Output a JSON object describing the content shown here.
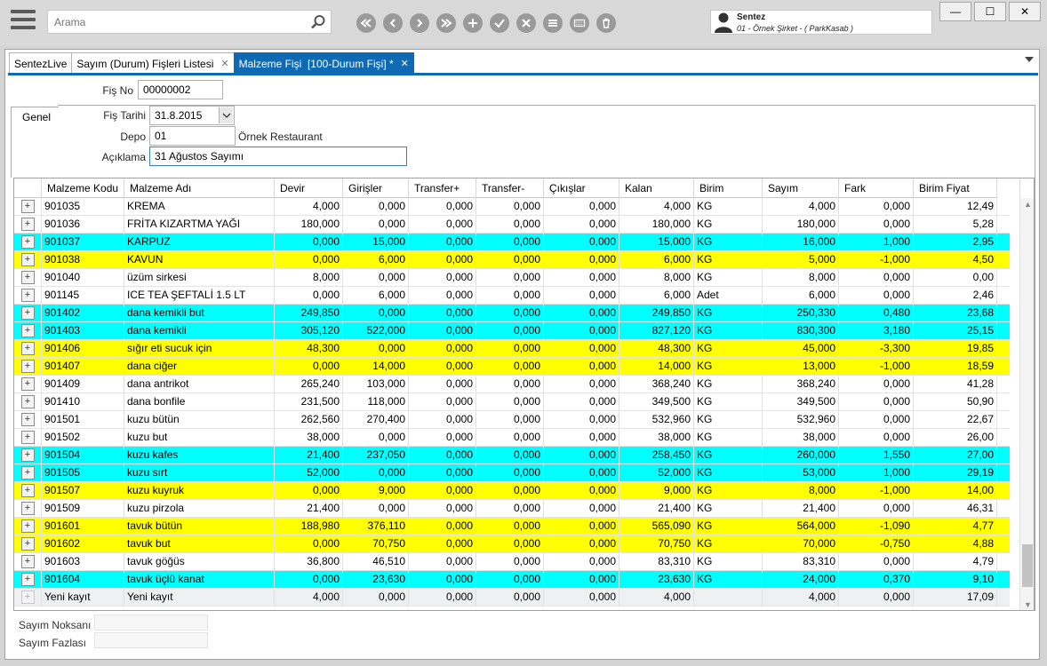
{
  "search": {
    "placeholder": "Arama"
  },
  "toolbar": [
    "first-icon",
    "prev-icon",
    "next-icon",
    "last-icon",
    "add-icon",
    "confirm-icon",
    "cancel-icon",
    "list-icon",
    "keyboard-icon",
    "delete-icon"
  ],
  "user": {
    "name": "Sentez",
    "company": "01 - Örnek Şirket - ( ParkKasab )"
  },
  "window": {
    "minimize": "—",
    "maximize": "☐",
    "close": "✕"
  },
  "tabs": [
    {
      "label": "SentezLive",
      "closable": false
    },
    {
      "label": "Sayım (Durum) Fişleri Listesi",
      "closable": true
    },
    {
      "label": "Malzeme Fişi  [100-Durum Fişi] *",
      "closable": true,
      "active": true
    }
  ],
  "form": {
    "fis_no_label": "Fiş No",
    "fis_no": "00000002",
    "genel_tab": "Genel",
    "fis_tarihi_label": "Fiş Tarihi",
    "fis_tarihi": "31.8.2015",
    "depo_label": "Depo",
    "depo_code": "01",
    "depo_name": "Örnek Restaurant",
    "aciklama_label": "Açıklama",
    "aciklama": "31 Ağustos Sayımı"
  },
  "grid": {
    "columns": [
      "Malzeme Kodu",
      "Malzeme Adı",
      "Devir",
      "Girişler",
      "Transfer+",
      "Transfer-",
      "Çıkışlar",
      "Kalan",
      "Birim",
      "Sayım",
      "Fark",
      "Birim Fiyat"
    ],
    "rows": [
      {
        "kod": "901035",
        "ad": "KREMA",
        "devir": "4,000",
        "giris": "0,000",
        "tplus": "0,000",
        "tminus": "0,000",
        "cikis": "0,000",
        "kalan": "4,000",
        "birim": "KG",
        "sayim": "4,000",
        "fark": "0,000",
        "fiyat": "12,49",
        "color": "#ffffff"
      },
      {
        "kod": "901036",
        "ad": "FRİTA KIZARTMA YAĞI",
        "devir": "180,000",
        "giris": "0,000",
        "tplus": "0,000",
        "tminus": "0,000",
        "cikis": "0,000",
        "kalan": "180,000",
        "birim": "KG",
        "sayim": "180,000",
        "fark": "0,000",
        "fiyat": "5,28",
        "color": "#ffffff"
      },
      {
        "kod": "901037",
        "ad": "KARPUZ",
        "devir": "0,000",
        "giris": "15,000",
        "tplus": "0,000",
        "tminus": "0,000",
        "cikis": "0,000",
        "kalan": "15,000",
        "birim": "KG",
        "sayim": "16,000",
        "fark": "1,000",
        "fiyat": "2,95",
        "color": "#00ffff"
      },
      {
        "kod": "901038",
        "ad": "KAVUN",
        "devir": "0,000",
        "giris": "6,000",
        "tplus": "0,000",
        "tminus": "0,000",
        "cikis": "0,000",
        "kalan": "6,000",
        "birim": "KG",
        "sayim": "5,000",
        "fark": "-1,000",
        "fiyat": "4,50",
        "color": "#ffff00"
      },
      {
        "kod": "901040",
        "ad": "üzüm sirkesi",
        "devir": "8,000",
        "giris": "0,000",
        "tplus": "0,000",
        "tminus": "0,000",
        "cikis": "0,000",
        "kalan": "8,000",
        "birim": "KG",
        "sayim": "8,000",
        "fark": "0,000",
        "fiyat": "0,00",
        "color": "#ffffff"
      },
      {
        "kod": "901145",
        "ad": "ICE TEA ŞEFTALİ 1.5 LT",
        "devir": "0,000",
        "giris": "6,000",
        "tplus": "0,000",
        "tminus": "0,000",
        "cikis": "0,000",
        "kalan": "6,000",
        "birim": "Adet",
        "sayim": "6,000",
        "fark": "0,000",
        "fiyat": "2,46",
        "color": "#ffffff"
      },
      {
        "kod": "901402",
        "ad": "dana kemikli but",
        "devir": "249,850",
        "giris": "0,000",
        "tplus": "0,000",
        "tminus": "0,000",
        "cikis": "0,000",
        "kalan": "249,850",
        "birim": "KG",
        "sayim": "250,330",
        "fark": "0,480",
        "fiyat": "23,68",
        "color": "#00ffff"
      },
      {
        "kod": "901403",
        "ad": "dana kemikli",
        "devir": "305,120",
        "giris": "522,000",
        "tplus": "0,000",
        "tminus": "0,000",
        "cikis": "0,000",
        "kalan": "827,120",
        "birim": "KG",
        "sayim": "830,300",
        "fark": "3,180",
        "fiyat": "25,15",
        "color": "#00ffff"
      },
      {
        "kod": "901406",
        "ad": "sığır eti sucuk için",
        "devir": "48,300",
        "giris": "0,000",
        "tplus": "0,000",
        "tminus": "0,000",
        "cikis": "0,000",
        "kalan": "48,300",
        "birim": "KG",
        "sayim": "45,000",
        "fark": "-3,300",
        "fiyat": "19,85",
        "color": "#ffff00"
      },
      {
        "kod": "901407",
        "ad": "dana ciğer",
        "devir": "0,000",
        "giris": "14,000",
        "tplus": "0,000",
        "tminus": "0,000",
        "cikis": "0,000",
        "kalan": "14,000",
        "birim": "KG",
        "sayim": "13,000",
        "fark": "-1,000",
        "fiyat": "18,59",
        "color": "#ffff00"
      },
      {
        "kod": "901409",
        "ad": "dana antrikot",
        "devir": "265,240",
        "giris": "103,000",
        "tplus": "0,000",
        "tminus": "0,000",
        "cikis": "0,000",
        "kalan": "368,240",
        "birim": "KG",
        "sayim": "368,240",
        "fark": "0,000",
        "fiyat": "41,28",
        "color": "#ffffff"
      },
      {
        "kod": "901410",
        "ad": "dana bonfile",
        "devir": "231,500",
        "giris": "118,000",
        "tplus": "0,000",
        "tminus": "0,000",
        "cikis": "0,000",
        "kalan": "349,500",
        "birim": "KG",
        "sayim": "349,500",
        "fark": "0,000",
        "fiyat": "50,90",
        "color": "#ffffff"
      },
      {
        "kod": "901501",
        "ad": "kuzu bütün",
        "devir": "262,560",
        "giris": "270,400",
        "tplus": "0,000",
        "tminus": "0,000",
        "cikis": "0,000",
        "kalan": "532,960",
        "birim": "KG",
        "sayim": "532,960",
        "fark": "0,000",
        "fiyat": "22,67",
        "color": "#ffffff"
      },
      {
        "kod": "901502",
        "ad": "kuzu but",
        "devir": "38,000",
        "giris": "0,000",
        "tplus": "0,000",
        "tminus": "0,000",
        "cikis": "0,000",
        "kalan": "38,000",
        "birim": "KG",
        "sayim": "38,000",
        "fark": "0,000",
        "fiyat": "26,00",
        "color": "#ffffff"
      },
      {
        "kod": "901504",
        "ad": "kuzu kafes",
        "devir": "21,400",
        "giris": "237,050",
        "tplus": "0,000",
        "tminus": "0,000",
        "cikis": "0,000",
        "kalan": "258,450",
        "birim": "KG",
        "sayim": "260,000",
        "fark": "1,550",
        "fiyat": "27,00",
        "color": "#00ffff"
      },
      {
        "kod": "901505",
        "ad": "kuzu sırt",
        "devir": "52,000",
        "giris": "0,000",
        "tplus": "0,000",
        "tminus": "0,000",
        "cikis": "0,000",
        "kalan": "52,000",
        "birim": "KG",
        "sayim": "53,000",
        "fark": "1,000",
        "fiyat": "29,19",
        "color": "#00ffff"
      },
      {
        "kod": "901507",
        "ad": "kuzu kuyruk",
        "devir": "0,000",
        "giris": "9,000",
        "tplus": "0,000",
        "tminus": "0,000",
        "cikis": "0,000",
        "kalan": "9,000",
        "birim": "KG",
        "sayim": "8,000",
        "fark": "-1,000",
        "fiyat": "14,00",
        "color": "#ffff00"
      },
      {
        "kod": "901509",
        "ad": "kuzu pirzola",
        "devir": "21,400",
        "giris": "0,000",
        "tplus": "0,000",
        "tminus": "0,000",
        "cikis": "0,000",
        "kalan": "21,400",
        "birim": "KG",
        "sayim": "21,400",
        "fark": "0,000",
        "fiyat": "46,31",
        "color": "#ffffff"
      },
      {
        "kod": "901601",
        "ad": "tavuk bütün",
        "devir": "188,980",
        "giris": "376,110",
        "tplus": "0,000",
        "tminus": "0,000",
        "cikis": "0,000",
        "kalan": "565,090",
        "birim": "KG",
        "sayim": "564,000",
        "fark": "-1,090",
        "fiyat": "4,77",
        "color": "#ffff00"
      },
      {
        "kod": "901602",
        "ad": "tavuk but",
        "devir": "0,000",
        "giris": "70,750",
        "tplus": "0,000",
        "tminus": "0,000",
        "cikis": "0,000",
        "kalan": "70,750",
        "birim": "KG",
        "sayim": "70,000",
        "fark": "-0,750",
        "fiyat": "4,88",
        "color": "#ffff00"
      },
      {
        "kod": "901603",
        "ad": "tavuk göğüs",
        "devir": "36,800",
        "giris": "46,510",
        "tplus": "0,000",
        "tminus": "0,000",
        "cikis": "0,000",
        "kalan": "83,310",
        "birim": "KG",
        "sayim": "83,310",
        "fark": "0,000",
        "fiyat": "4,79",
        "color": "#ffffff"
      },
      {
        "kod": "901604",
        "ad": "tavuk üçlü kanat",
        "devir": "0,000",
        "giris": "23,630",
        "tplus": "0,000",
        "tminus": "0,000",
        "cikis": "0,000",
        "kalan": "23,630",
        "birim": "KG",
        "sayim": "24,000",
        "fark": "0,370",
        "fiyat": "9,10",
        "color": "#00ffff"
      }
    ],
    "new_row": {
      "kod": "Yeni kayıt",
      "ad": "Yeni kayıt",
      "devir": "4,000",
      "giris": "0,000",
      "tplus": "0,000",
      "tminus": "0,000",
      "cikis": "0,000",
      "kalan": "4,000",
      "birim": "",
      "sayim": "4,000",
      "fark": "0,000",
      "fiyat": "17,09"
    }
  },
  "summary": {
    "noksan_label": "Sayım Noksanı",
    "fazla_label": "Sayım Fazlası"
  }
}
